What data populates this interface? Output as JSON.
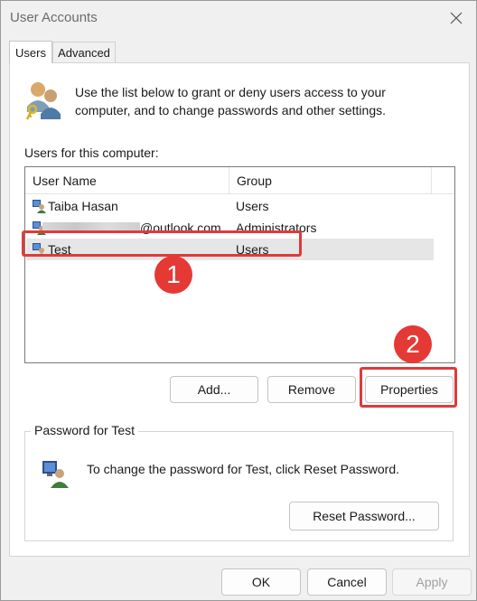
{
  "window": {
    "title": "User Accounts"
  },
  "tabs": [
    {
      "label": "Users",
      "active": true
    },
    {
      "label": "Advanced",
      "active": false
    }
  ],
  "intro_text": "Use the list below to grant or deny users access to your computer, and to change passwords and other settings.",
  "users_label": "Users for this computer:",
  "list": {
    "columns": [
      "User Name",
      "Group"
    ],
    "rows": [
      {
        "name": "Taiba Hasan",
        "group": "Users",
        "selected": false
      },
      {
        "name": "@outlook.com",
        "name_redacted_prefix": true,
        "group": "Administrators",
        "selected": false
      },
      {
        "name": "Test",
        "group": "Users",
        "selected": true
      }
    ]
  },
  "buttons": {
    "add": "Add...",
    "remove": "Remove",
    "properties": "Properties"
  },
  "password_group": {
    "legend": "Password for Test",
    "text": "To change the password for Test, click Reset Password.",
    "reset_button": "Reset Password..."
  },
  "dialog_buttons": {
    "ok": "OK",
    "cancel": "Cancel",
    "apply": "Apply"
  },
  "annotations": {
    "badge_1": "1",
    "badge_2": "2",
    "highlight_color": "#e03a3a",
    "badge_color": "#e53935"
  }
}
